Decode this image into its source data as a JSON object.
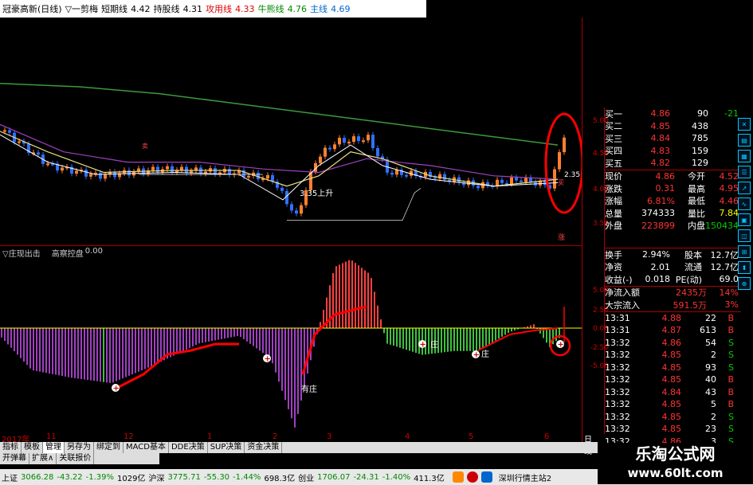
{
  "header": {
    "title": "冠豪高新(日线)",
    "indicator": "▽一剪梅",
    "items": [
      {
        "label": "短期线",
        "value": "4.42"
      },
      {
        "label": "持股线",
        "value": "4.31"
      },
      {
        "label": "攻用线",
        "value": "4.33"
      },
      {
        "label": "牛熊线",
        "value": "4.76"
      },
      {
        "label": "主线",
        "value": "4.69"
      }
    ]
  },
  "price_axis": [
    "5.00",
    "4.50",
    "4.00",
    "3.50"
  ],
  "indicator_bar": {
    "name": "▽庄现出击",
    "label": "高察控盘",
    "value": "0.00"
  },
  "indicator_axis": [
    "5.00",
    "2.50",
    "0.00",
    "-2.50",
    "-5.00"
  ],
  "annotations": {
    "up": "3.35上升",
    "youzhuang": "有庄",
    "zhuang1": "庄",
    "zhuang2": "庄",
    "p235": "2.35",
    "buy": "买",
    "sell": "卖",
    "zhong": "涨"
  },
  "quote": {
    "bids": [
      {
        "label": "买一",
        "price": "4.86",
        "vol": "90",
        "chg": "-21"
      },
      {
        "label": "买二",
        "price": "4.85",
        "vol": "438",
        "chg": ""
      },
      {
        "label": "买三",
        "price": "4.84",
        "vol": "785",
        "chg": ""
      },
      {
        "label": "买四",
        "price": "4.83",
        "vol": "159",
        "chg": ""
      },
      {
        "label": "买五",
        "price": "4.82",
        "vol": "129",
        "chg": ""
      }
    ],
    "stats": [
      {
        "l1": "现价",
        "v1": "4.86",
        "l2": "今开",
        "v2": "4.52"
      },
      {
        "l1": "涨跌",
        "v1": "0.31",
        "l2": "最高",
        "v2": "4.95"
      },
      {
        "l1": "涨幅",
        "v1": "6.81%",
        "l2": "最低",
        "v2": "4.46"
      },
      {
        "l1": "总量",
        "v1": "374333",
        "l2": "量比",
        "v2": "7.84"
      },
      {
        "l1": "外盘",
        "v1": "223899",
        "l2": "内盘",
        "v2": "150434"
      }
    ],
    "stats2": [
      {
        "l1": "换手",
        "v1": "2.94%",
        "l2": "股本",
        "v2": "12.7亿"
      },
      {
        "l1": "净资",
        "v1": "2.01",
        "l2": "流通",
        "v2": "12.7亿"
      },
      {
        "l1": "收益(-)",
        "v1": "0.018",
        "l2": "PE(动)",
        "v2": "69.0"
      }
    ],
    "flows": [
      {
        "label": "净流入额",
        "value": "2435万",
        "pct": "14%"
      },
      {
        "label": "大宗流入",
        "value": "591.5万",
        "pct": "3%"
      }
    ],
    "ticks": [
      {
        "t": "13:31",
        "p": "4.88",
        "v": "22",
        "d": "B"
      },
      {
        "t": "13:31",
        "p": "4.87",
        "v": "613",
        "d": "B"
      },
      {
        "t": "13:32",
        "p": "4.86",
        "v": "54",
        "d": "S"
      },
      {
        "t": "13:32",
        "p": "4.85",
        "v": "2",
        "d": "S"
      },
      {
        "t": "13:32",
        "p": "4.85",
        "v": "93",
        "d": "S"
      },
      {
        "t": "13:32",
        "p": "4.85",
        "v": "40",
        "d": "B"
      },
      {
        "t": "13:32",
        "p": "4.84",
        "v": "43",
        "d": "B"
      },
      {
        "t": "13:32",
        "p": "4.85",
        "v": "5",
        "d": "B"
      },
      {
        "t": "13:32",
        "p": "4.85",
        "v": "2",
        "d": "S"
      },
      {
        "t": "13:32",
        "p": "4.85",
        "v": "23",
        "d": "S"
      },
      {
        "t": "13:32",
        "p": "4.86",
        "v": "3",
        "d": "S"
      }
    ]
  },
  "xaxis": [
    "2017年",
    "11",
    "12",
    "1",
    "2",
    "3",
    "4",
    "5",
    "6",
    "日线"
  ],
  "tabs": [
    "指标",
    "模板",
    "管理",
    "另存为",
    "绑定到",
    "MACD基本",
    "DDE决策",
    "SUP决策",
    "资金决策"
  ],
  "tabs2": [
    "开弹幕",
    "扩展∧",
    "关联报价"
  ],
  "status": {
    "sh_label": "上证",
    "sh": "3066.28",
    "sh_chg": "-43.22",
    "sh_pct": "-1.39%",
    "sh_amt": "1029亿",
    "sz_label": "沪深",
    "sz": "3775.71",
    "sz_chg": "-55.30",
    "sz_pct": "-1.44%",
    "sz_amt": "698.3亿",
    "cy_label": "创业",
    "cy": "1706.07",
    "cy_chg": "-24.31",
    "cy_pct": "-1.40%",
    "cy_amt": "411.3亿",
    "server": "深圳行情主站2"
  },
  "watermark": {
    "line1": "乐淘公式网",
    "line2": "www.60lt.com"
  },
  "colors": {
    "up": "#ff3030",
    "down": "#00c000",
    "ma_long": "#3c9a3c",
    "ma_mid": "#a040c0",
    "ma_short": "#ffffff",
    "ma_yellow": "#f0e080"
  }
}
